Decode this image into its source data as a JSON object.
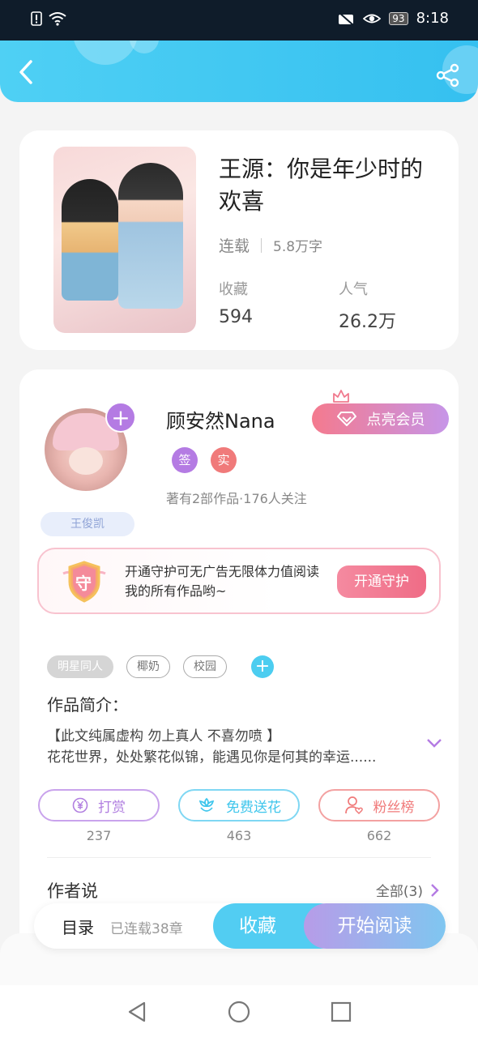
{
  "status_bar": {
    "battery": "93",
    "time": "8:18"
  },
  "book": {
    "title": "王源：你是年少时的欢喜",
    "status": "连载",
    "word_count": "5.8万字",
    "stats": [
      {
        "label": "收藏",
        "value": "594"
      },
      {
        "label": "人气",
        "value": "26.2万"
      }
    ]
  },
  "author": {
    "name": "顾安然Nana",
    "vip_label": "点亮会员",
    "badges": [
      "签",
      "实"
    ],
    "summary": "著有2部作品·176人关注",
    "fan_tag": "王俊凯"
  },
  "guard": {
    "icon_text": "守",
    "text": "开通守护可无广告无限体力值阅读我的所有作品哟~",
    "button": "开通守护"
  },
  "tags": [
    "明星同人",
    "椰奶",
    "校园"
  ],
  "intro": {
    "label": "作品简介：",
    "line1": "【此文纯属虚构 勿上真人 不喜勿喷 】",
    "line2": "花花世界，处处繁花似锦，能遇见你是何其的幸运......"
  },
  "actions": [
    {
      "label": "打赏",
      "count": "237",
      "icon": "yen-circle-icon",
      "color": "#b17fe0"
    },
    {
      "label": "免费送花",
      "count": "463",
      "icon": "flower-icon",
      "color": "#3fc6ec"
    },
    {
      "label": "粉丝榜",
      "count": "662",
      "icon": "user-heart-icon",
      "color": "#f07a7a"
    }
  ],
  "author_says": {
    "label": "作者说",
    "all": "全部(3)"
  },
  "bottom_bar": {
    "toc": "目录",
    "chapters": "已连载38章",
    "favorite": "收藏",
    "start_reading": "开始阅读"
  },
  "colors": {
    "accent": "#4fd0f4",
    "purple": "#b47be3",
    "pink": "#ef6c86"
  }
}
